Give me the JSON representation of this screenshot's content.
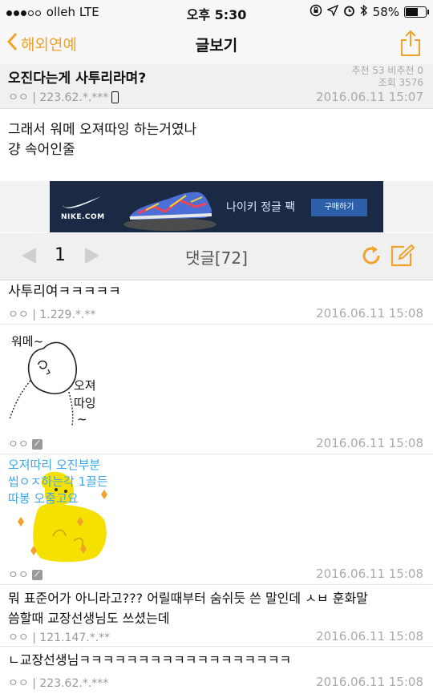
{
  "status_bar": {
    "carrier": "olleh",
    "network": "LTE",
    "time": "오후 5:30",
    "battery": "58%"
  },
  "nav": {
    "back_label": "해외연예",
    "title": "글보기"
  },
  "post": {
    "title": "오진다는게 사투리라며?",
    "recommend": "추천 53 비추천 0",
    "views": "조회 3576",
    "author": "ㅇㅇ | 223.62.*.***",
    "date": "2016.06.11 15:07",
    "body_line1": "그래서 워메 오져따잉 하는거였나",
    "body_line2": "걍 속어인줄"
  },
  "ad": {
    "brand": "NIKE.COM",
    "headline": "나이키 정글 팩",
    "button": "구매하기"
  },
  "pager": {
    "page": "1",
    "comments_title": "댓글[72]"
  },
  "comments": [
    {
      "text": "사투리여ㅋㅋㅋㅋㅋ",
      "author": "ㅇㅇ | 1.229.*.**",
      "date": "2016.06.11 15:08"
    },
    {
      "drawing_text_1": "워메~",
      "drawing_text_2": "오져",
      "drawing_text_3": "따잉",
      "drawing_text_4": "~",
      "author": "ㅇㅇ",
      "date": "2016.06.11 15:08"
    },
    {
      "drawing_line1": "오져따리 오진부분",
      "drawing_line2": "씹ㅇㅈ하는각 1끌든",
      "drawing_line3": "따봉 오줌고요",
      "author": "ㅇㅇ",
      "date": "2016.06.11 15:08"
    },
    {
      "text_line1": "뭐 표준어가 아니라고??? 어릴때부터 숨쉬듯 쓴 말인데 ㅅㅂ 훈화말",
      "text_line2": "씀할때 교장선생님도 쓰셨는데",
      "author": "ㅇㅇ | 121.147.*.**",
      "date": "2016.06.11 15:08"
    },
    {
      "text": "ㄴ교장선생님ㅋㅋㅋㅋㅋㅋㅋㅋㅋㅋㅋㅋㅋㅋㅋㅋㅋㅋ",
      "author": "ㅇㅇ | 223.62.*.***",
      "date": "2016.06.11 15:08"
    }
  ],
  "colors": {
    "accent": "#f0a22a",
    "meta": "#999999",
    "drawing_blue": "#3fa7e8",
    "character_yellow": "#f5e000"
  },
  "icons": [
    "chevron-left-icon",
    "share-icon",
    "phone-icon",
    "prev-arrow-icon",
    "next-arrow-icon",
    "refresh-icon",
    "write-icon",
    "image-icon"
  ]
}
